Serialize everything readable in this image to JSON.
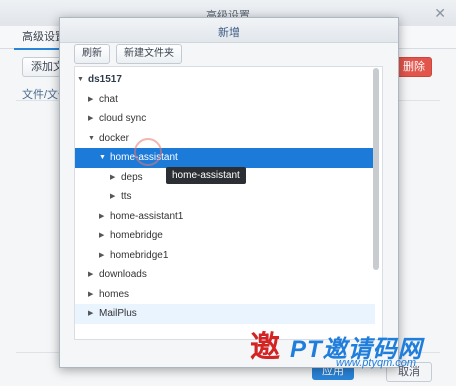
{
  "background_window": {
    "title": "高级设置",
    "tab": "高级设置",
    "add_button": "添加文件",
    "delete_button": "删除",
    "column_header": "文件/文件夹",
    "ok_button": "应用",
    "cancel_button": "取消"
  },
  "dialog": {
    "title": "新增",
    "refresh_button": "刷新",
    "new_folder_button": "新建文件夹",
    "tree": [
      {
        "label": "ds1517",
        "level": 0,
        "expanded": true,
        "root": true
      },
      {
        "label": "chat",
        "level": 1,
        "expanded": false
      },
      {
        "label": "cloud sync",
        "level": 1,
        "expanded": false
      },
      {
        "label": "docker",
        "level": 1,
        "expanded": true
      },
      {
        "label": "home-assistant",
        "level": 2,
        "expanded": true,
        "selected": true
      },
      {
        "label": "deps",
        "level": 3,
        "expanded": false
      },
      {
        "label": "tts",
        "level": 3,
        "expanded": false
      },
      {
        "label": "home-assistant1",
        "level": 2,
        "expanded": false
      },
      {
        "label": "homebridge",
        "level": 2,
        "expanded": false
      },
      {
        "label": "homebridge1",
        "level": 2,
        "expanded": false
      },
      {
        "label": "downloads",
        "level": 1,
        "expanded": false
      },
      {
        "label": "homes",
        "level": 1,
        "expanded": false
      },
      {
        "label": "MailPlus",
        "level": 1,
        "expanded": false,
        "hover": true
      }
    ],
    "tooltip": "home-assistant"
  },
  "watermark": {
    "seal": "邀",
    "brand": "PT邀请码网",
    "url": "www.ptyqm.com"
  },
  "colors": {
    "accent": "#1c7ad9",
    "danger": "#e2554c",
    "watermark_red": "#d32323",
    "watermark_blue": "#1f7ddc"
  }
}
